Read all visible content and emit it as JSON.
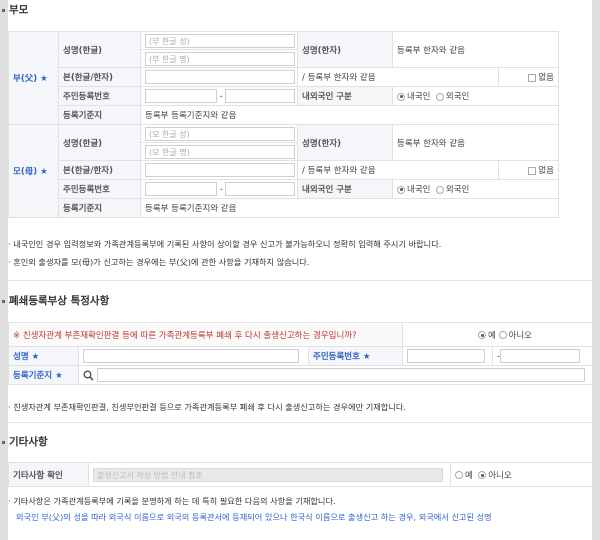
{
  "parents": {
    "title": "부모",
    "father_label": "부(父)",
    "mother_label": "모(母)",
    "name_kr_label": "성명(한글)",
    "name_hanja_label": "성명(한자)",
    "surname_placeholder": "(부 한글 성)",
    "givenname_placeholder": "(부 한글 명)",
    "mother_surname_placeholder": "(모 한글 성)",
    "mother_givenname_placeholder": "(모 한글 명)",
    "hanja_same": "등록부 한자와 같음",
    "origin_label": "본(한글/한자)",
    "origin_hint": "/ 등록부 한자와 같음",
    "none_label": "없음",
    "rrn_label": "주민등록번호",
    "rrn_sep": "-",
    "nationality_label": "내외국인 구분",
    "domestic": "내국인",
    "foreign": "외국인",
    "base_label": "등록기준지",
    "base_same": "등록부 등록기준지와 같음",
    "note1": "· 내국인인 경우 입력정보와 가족관계등록부에 기록된 사항이 상이할 경우 신고가 불가능하오니 정확히 입력해 주시기 바랍니다.",
    "note2": "· 혼인외 출생자를 모(母)가 신고하는 경우에는 부(父)에 관한 사항을 기재하지 않습니다."
  },
  "closure": {
    "title": "폐쇄등록부상 특정사항",
    "question": "※ 친생자관계 부존재확인판결 등에 따른 가족관계등록부 폐쇄 후 다시 출생신고하는 경우입니까?",
    "yes": "예",
    "no": "아니오",
    "name_label": "성명",
    "rrn_label": "주민등록번호",
    "base_label": "등록기준지",
    "note": "· 친생자관계 부존재확인판결, 친생부인판결 등으로 가족관계등록부 폐쇄 후 다시 출생신고하는 경우에만 기재합니다."
  },
  "other": {
    "title": "기타사항",
    "confirm_label": "기타사항 확인",
    "guide_placeholder": "출생신고서 작성 방법 안내 참조",
    "yes": "예",
    "no": "아니오",
    "note1": "· 기타사항은 가족관계등록부에 기록을 분명하게 하는 데 특히 필요한 다음의 사항을 기재합니다.",
    "note2": "외국인 부(父)의 성을 따라 외국식 이름으로 외국의 등록관서에 등재되어 있으나 한국식 이름으로 출생신고 하는 경우, 외국에서 신고된 성명"
  },
  "colors": {
    "blue": "#2e64c8",
    "label_bg": "#f5f6fa"
  }
}
